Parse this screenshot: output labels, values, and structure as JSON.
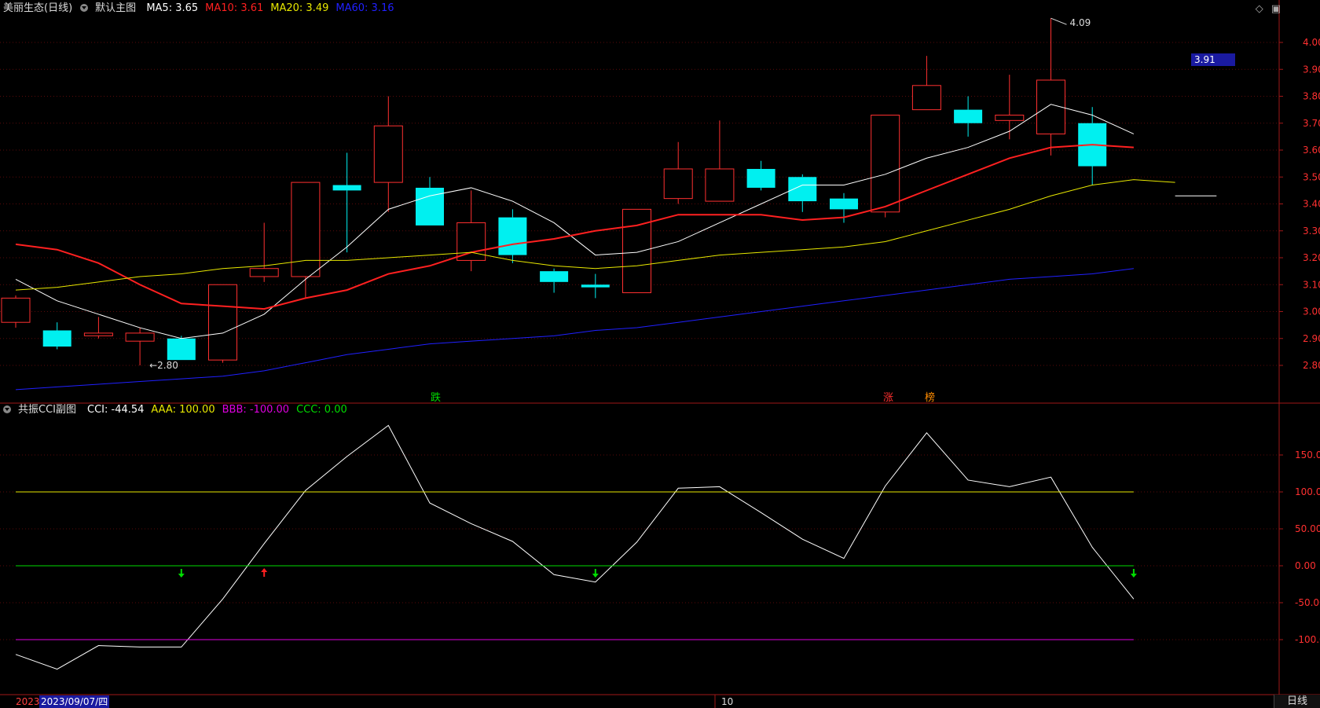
{
  "main_panel": {
    "title": "美丽生态(日线)",
    "chart_name": "默认主图",
    "ma_labels": [
      {
        "text": "MA5: 3.65",
        "color": "#ffffff"
      },
      {
        "text": "MA10: 3.61",
        "color": "#ff2020"
      },
      {
        "text": "MA20: 3.49",
        "color": "#e8e800"
      },
      {
        "text": "MA60: 3.16",
        "color": "#2020ff"
      }
    ],
    "current_price": "3.91",
    "high_label": "4.09",
    "low_label": "2.80",
    "markers": [
      {
        "text": "跌",
        "color": "#00dd00"
      },
      {
        "text": "涨",
        "color": "#ff3030"
      },
      {
        "text": "榜",
        "color": "#ff8c00"
      }
    ],
    "icons": [
      "diamond-icon",
      "restore-icon"
    ]
  },
  "sub_panel": {
    "title": "共振CCI副图",
    "labels": [
      {
        "text": "CCI: -44.54",
        "color": "#ffffff"
      },
      {
        "text": "AAA: 100.00",
        "color": "#e8e800"
      },
      {
        "text": "BBB: -100.00",
        "color": "#e000e0"
      },
      {
        "text": "CCC: 0.00",
        "color": "#00dd00"
      }
    ]
  },
  "bottom": {
    "year": "2023",
    "date": "2023/09/07/四",
    "month": "10",
    "period_button": "日线"
  },
  "chart_data": [
    {
      "type": "candlestick",
      "y_ticks": [
        "4.00",
        "3.90",
        "3.80",
        "3.70",
        "3.60",
        "3.50",
        "3.40",
        "3.30",
        "3.20",
        "3.10",
        "3.00",
        "2.90",
        "2.80"
      ],
      "ylim": [
        2.8,
        4.09
      ],
      "candles": [
        {
          "o": 2.96,
          "h": 3.06,
          "l": 2.94,
          "c": 3.05
        },
        {
          "o": 2.93,
          "h": 2.96,
          "l": 2.86,
          "c": 2.87
        },
        {
          "o": 2.91,
          "h": 2.98,
          "l": 2.9,
          "c": 2.92
        },
        {
          "o": 2.89,
          "h": 2.94,
          "l": 2.8,
          "c": 2.92
        },
        {
          "o": 2.9,
          "h": 2.91,
          "l": 2.82,
          "c": 2.82
        },
        {
          "o": 2.82,
          "h": 3.1,
          "l": 2.81,
          "c": 3.1
        },
        {
          "o": 3.13,
          "h": 3.33,
          "l": 3.11,
          "c": 3.16
        },
        {
          "o": 3.13,
          "h": 3.48,
          "l": 3.05,
          "c": 3.48
        },
        {
          "o": 3.47,
          "h": 3.59,
          "l": 3.22,
          "c": 3.45
        },
        {
          "o": 3.48,
          "h": 3.8,
          "l": 3.37,
          "c": 3.69
        },
        {
          "o": 3.46,
          "h": 3.5,
          "l": 3.32,
          "c": 3.32
        },
        {
          "o": 3.19,
          "h": 3.45,
          "l": 3.15,
          "c": 3.33
        },
        {
          "o": 3.35,
          "h": 3.38,
          "l": 3.18,
          "c": 3.21
        },
        {
          "o": 3.15,
          "h": 3.16,
          "l": 3.07,
          "c": 3.11
        },
        {
          "o": 3.1,
          "h": 3.14,
          "l": 3.05,
          "c": 3.09
        },
        {
          "o": 3.07,
          "h": 3.38,
          "l": 3.07,
          "c": 3.38
        },
        {
          "o": 3.42,
          "h": 3.63,
          "l": 3.4,
          "c": 3.53
        },
        {
          "o": 3.41,
          "h": 3.71,
          "l": 3.41,
          "c": 3.53
        },
        {
          "o": 3.53,
          "h": 3.56,
          "l": 3.45,
          "c": 3.46
        },
        {
          "o": 3.5,
          "h": 3.51,
          "l": 3.37,
          "c": 3.41
        },
        {
          "o": 3.42,
          "h": 3.44,
          "l": 3.33,
          "c": 3.38
        },
        {
          "o": 3.37,
          "h": 3.73,
          "l": 3.35,
          "c": 3.73
        },
        {
          "o": 3.75,
          "h": 3.95,
          "l": 3.75,
          "c": 3.84
        },
        {
          "o": 3.75,
          "h": 3.8,
          "l": 3.65,
          "c": 3.7
        },
        {
          "o": 3.71,
          "h": 3.88,
          "l": 3.64,
          "c": 3.73
        },
        {
          "o": 3.66,
          "h": 4.09,
          "l": 3.58,
          "c": 3.86
        },
        {
          "o": 3.7,
          "h": 3.76,
          "l": 3.47,
          "c": 3.54
        }
      ],
      "series": [
        {
          "name": "MA5",
          "color": "#ffffff",
          "values": [
            3.12,
            3.04,
            2.99,
            2.94,
            2.9,
            2.92,
            2.99,
            3.12,
            3.24,
            3.38,
            3.43,
            3.46,
            3.41,
            3.33,
            3.21,
            3.22,
            3.26,
            3.33,
            3.4,
            3.47,
            3.47,
            3.51,
            3.57,
            3.61,
            3.67,
            3.77,
            3.73,
            3.66
          ]
        },
        {
          "name": "MA10",
          "color": "#ff2020",
          "values": [
            3.25,
            3.23,
            3.18,
            3.1,
            3.03,
            3.02,
            3.01,
            3.05,
            3.08,
            3.14,
            3.17,
            3.22,
            3.25,
            3.27,
            3.3,
            3.32,
            3.36,
            3.36,
            3.36,
            3.34,
            3.35,
            3.39,
            3.45,
            3.51,
            3.57,
            3.61,
            3.62,
            3.61
          ]
        },
        {
          "name": "MA20",
          "color": "#e8e800",
          "values": [
            3.08,
            3.09,
            3.11,
            3.13,
            3.14,
            3.16,
            3.17,
            3.19,
            3.19,
            3.2,
            3.21,
            3.22,
            3.19,
            3.17,
            3.16,
            3.17,
            3.19,
            3.21,
            3.22,
            3.23,
            3.24,
            3.26,
            3.3,
            3.34,
            3.38,
            3.43,
            3.47,
            3.49,
            3.48
          ]
        },
        {
          "name": "MA60",
          "color": "#2020ff",
          "values": [
            2.71,
            2.72,
            2.73,
            2.74,
            2.75,
            2.76,
            2.78,
            2.81,
            2.84,
            2.86,
            2.88,
            2.89,
            2.9,
            2.91,
            2.93,
            2.94,
            2.96,
            2.98,
            3.0,
            3.02,
            3.04,
            3.06,
            3.08,
            3.1,
            3.12,
            3.13,
            3.14,
            3.16
          ]
        }
      ]
    },
    {
      "type": "line",
      "y_ticks": [
        "150.00",
        "100.00",
        "50.00",
        "0.00",
        "-50.00",
        "-100.00"
      ],
      "ylim": [
        -150,
        200
      ],
      "series": [
        {
          "name": "CCI",
          "color": "#ffffff",
          "values": [
            -120,
            -140,
            -108,
            -110,
            -110,
            -45,
            30,
            102,
            148,
            190,
            85,
            57,
            33,
            -12,
            -22,
            32,
            105,
            107,
            72,
            36,
            10,
            108,
            180,
            116,
            107,
            120,
            25,
            -45
          ]
        },
        {
          "name": "AAA",
          "color": "#e8e800",
          "values": [
            100
          ]
        },
        {
          "name": "BBB",
          "color": "#e000e0",
          "values": [
            -100
          ]
        },
        {
          "name": "CCC",
          "color": "#00dd00",
          "values": [
            0
          ]
        }
      ],
      "signals": [
        {
          "index": 4,
          "direction": "down",
          "color": "#00dd00"
        },
        {
          "index": 6,
          "direction": "up",
          "color": "#ff2020"
        },
        {
          "index": 14,
          "direction": "down",
          "color": "#00dd00"
        },
        {
          "index": 27,
          "direction": "down",
          "color": "#00dd00"
        }
      ]
    }
  ]
}
